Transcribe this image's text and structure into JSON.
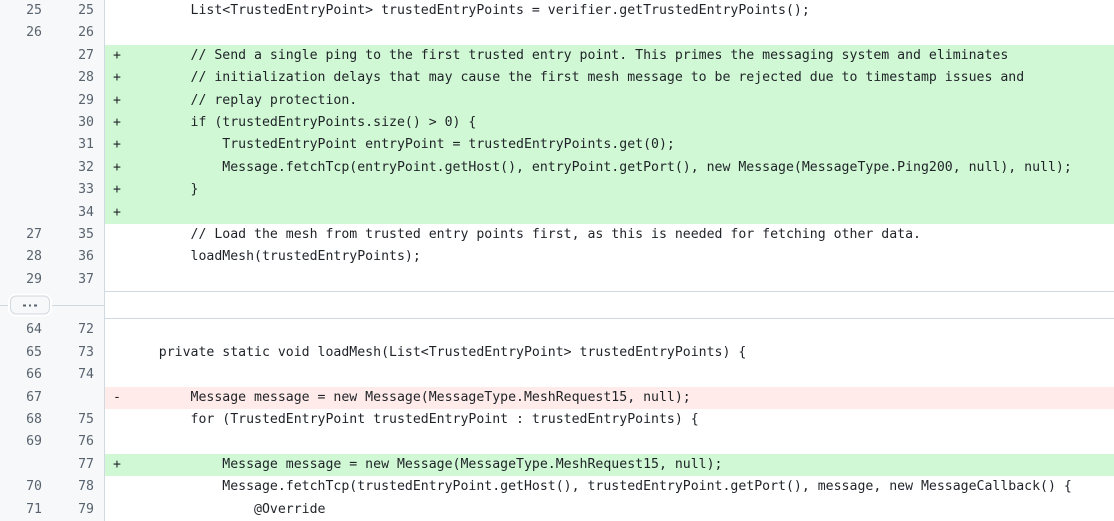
{
  "view": {
    "type": "split-diff",
    "language": "java",
    "colors": {
      "added_bg": "#d1f8d5",
      "removed_bg": "#ffebe9",
      "gutter_bg": "#f6f8fa",
      "border": "#d1d9e0",
      "text": "#1f2328",
      "line_number": "#59636e"
    }
  },
  "expander": {
    "name": "expand-hidden-lines-button",
    "label": "•••",
    "dots": 3
  },
  "rows": [
    {
      "old_num": "25",
      "new_num": "25",
      "marker": "",
      "kind": "ctx",
      "code": "        List<TrustedEntryPoint> trustedEntryPoints = verifier.getTrustedEntryPoints();"
    },
    {
      "old_num": "26",
      "new_num": "26",
      "marker": "",
      "kind": "ctx",
      "code": ""
    },
    {
      "old_num": "",
      "new_num": "27",
      "marker": "+",
      "kind": "add",
      "code": "        // Send a single ping to the first trusted entry point. This primes the messaging system and eliminates"
    },
    {
      "old_num": "",
      "new_num": "28",
      "marker": "+",
      "kind": "add",
      "code": "        // initialization delays that may cause the first mesh message to be rejected due to timestamp issues and"
    },
    {
      "old_num": "",
      "new_num": "29",
      "marker": "+",
      "kind": "add",
      "code": "        // replay protection."
    },
    {
      "old_num": "",
      "new_num": "30",
      "marker": "+",
      "kind": "add",
      "code": "        if (trustedEntryPoints.size() > 0) {"
    },
    {
      "old_num": "",
      "new_num": "31",
      "marker": "+",
      "kind": "add",
      "code": "            TrustedEntryPoint entryPoint = trustedEntryPoints.get(0);"
    },
    {
      "old_num": "",
      "new_num": "32",
      "marker": "+",
      "kind": "add",
      "code": "            Message.fetchTcp(entryPoint.getHost(), entryPoint.getPort(), new Message(MessageType.Ping200, null), null);"
    },
    {
      "old_num": "",
      "new_num": "33",
      "marker": "+",
      "kind": "add",
      "code": "        }"
    },
    {
      "old_num": "",
      "new_num": "34",
      "marker": "+",
      "kind": "add",
      "code": ""
    },
    {
      "old_num": "27",
      "new_num": "35",
      "marker": "",
      "kind": "ctx",
      "code": "        // Load the mesh from trusted entry points first, as this is needed for fetching other data."
    },
    {
      "old_num": "28",
      "new_num": "36",
      "marker": "",
      "kind": "ctx",
      "code": "        loadMesh(trustedEntryPoints);"
    },
    {
      "old_num": "29",
      "new_num": "37",
      "marker": "",
      "kind": "ctx",
      "code": ""
    },
    {
      "old_num": "64",
      "new_num": "72",
      "marker": "",
      "kind": "ctx",
      "code": ""
    },
    {
      "old_num": "65",
      "new_num": "73",
      "marker": "",
      "kind": "ctx",
      "code": "    private static void loadMesh(List<TrustedEntryPoint> trustedEntryPoints) {"
    },
    {
      "old_num": "66",
      "new_num": "74",
      "marker": "",
      "kind": "ctx",
      "code": ""
    },
    {
      "old_num": "67",
      "new_num": "",
      "marker": "-",
      "kind": "del",
      "code": "        Message message = new Message(MessageType.MeshRequest15, null);"
    },
    {
      "old_num": "68",
      "new_num": "75",
      "marker": "",
      "kind": "ctx",
      "code": "        for (TrustedEntryPoint trustedEntryPoint : trustedEntryPoints) {"
    },
    {
      "old_num": "69",
      "new_num": "76",
      "marker": "",
      "kind": "ctx",
      "code": ""
    },
    {
      "old_num": "",
      "new_num": "77",
      "marker": "+",
      "kind": "add",
      "code": "            Message message = new Message(MessageType.MeshRequest15, null);"
    },
    {
      "old_num": "70",
      "new_num": "78",
      "marker": "",
      "kind": "ctx",
      "code": "            Message.fetchTcp(trustedEntryPoint.getHost(), trustedEntryPoint.getPort(), message, new MessageCallback() {"
    },
    {
      "old_num": "71",
      "new_num": "79",
      "marker": "",
      "kind": "ctx",
      "code": "                @Override"
    }
  ],
  "expander_after_row_index": 12
}
